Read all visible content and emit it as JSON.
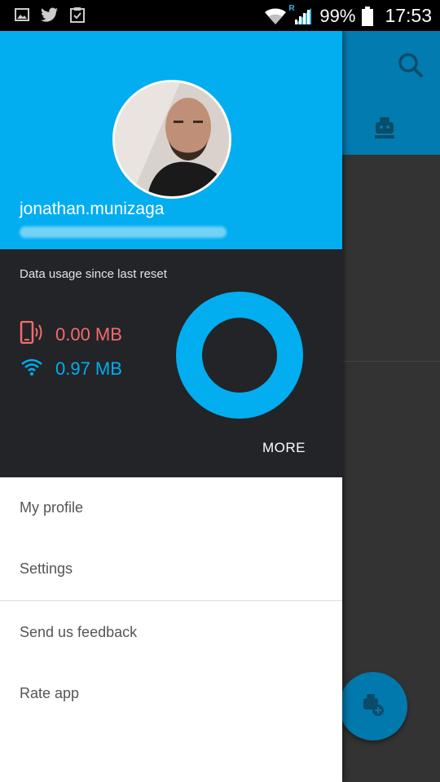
{
  "status_bar": {
    "battery_percent": "99%",
    "time": "17:53",
    "roaming_indicator": "R",
    "icons": [
      "gallery-icon",
      "twitter-icon",
      "clipboard-icon",
      "wifi-icon",
      "signal-icon",
      "battery-icon"
    ]
  },
  "background_app": {
    "icons": [
      "search-icon",
      "robot-icon",
      "add-robot-icon"
    ],
    "colors": {
      "toolbar": "#027bb0",
      "fab": "#0279ac"
    }
  },
  "drawer": {
    "profile": {
      "username": "jonathan.munizaga"
    },
    "data_usage": {
      "title": "Data usage since last reset",
      "mobile_value": "0.00 MB",
      "wifi_value": "0.97 MB",
      "more_label": "MORE",
      "mobile_fraction": 0.0,
      "wifi_fraction": 1.0,
      "colors": {
        "mobile": "#f36b6b",
        "wifi": "#02aeef"
      }
    },
    "menu_items": [
      {
        "label": "My profile"
      },
      {
        "label": "Settings"
      },
      {
        "label": "Send us feedback"
      },
      {
        "label": "Rate app"
      }
    ]
  },
  "colors": {
    "accent": "#02aeef",
    "usage_panel": "#222428"
  }
}
